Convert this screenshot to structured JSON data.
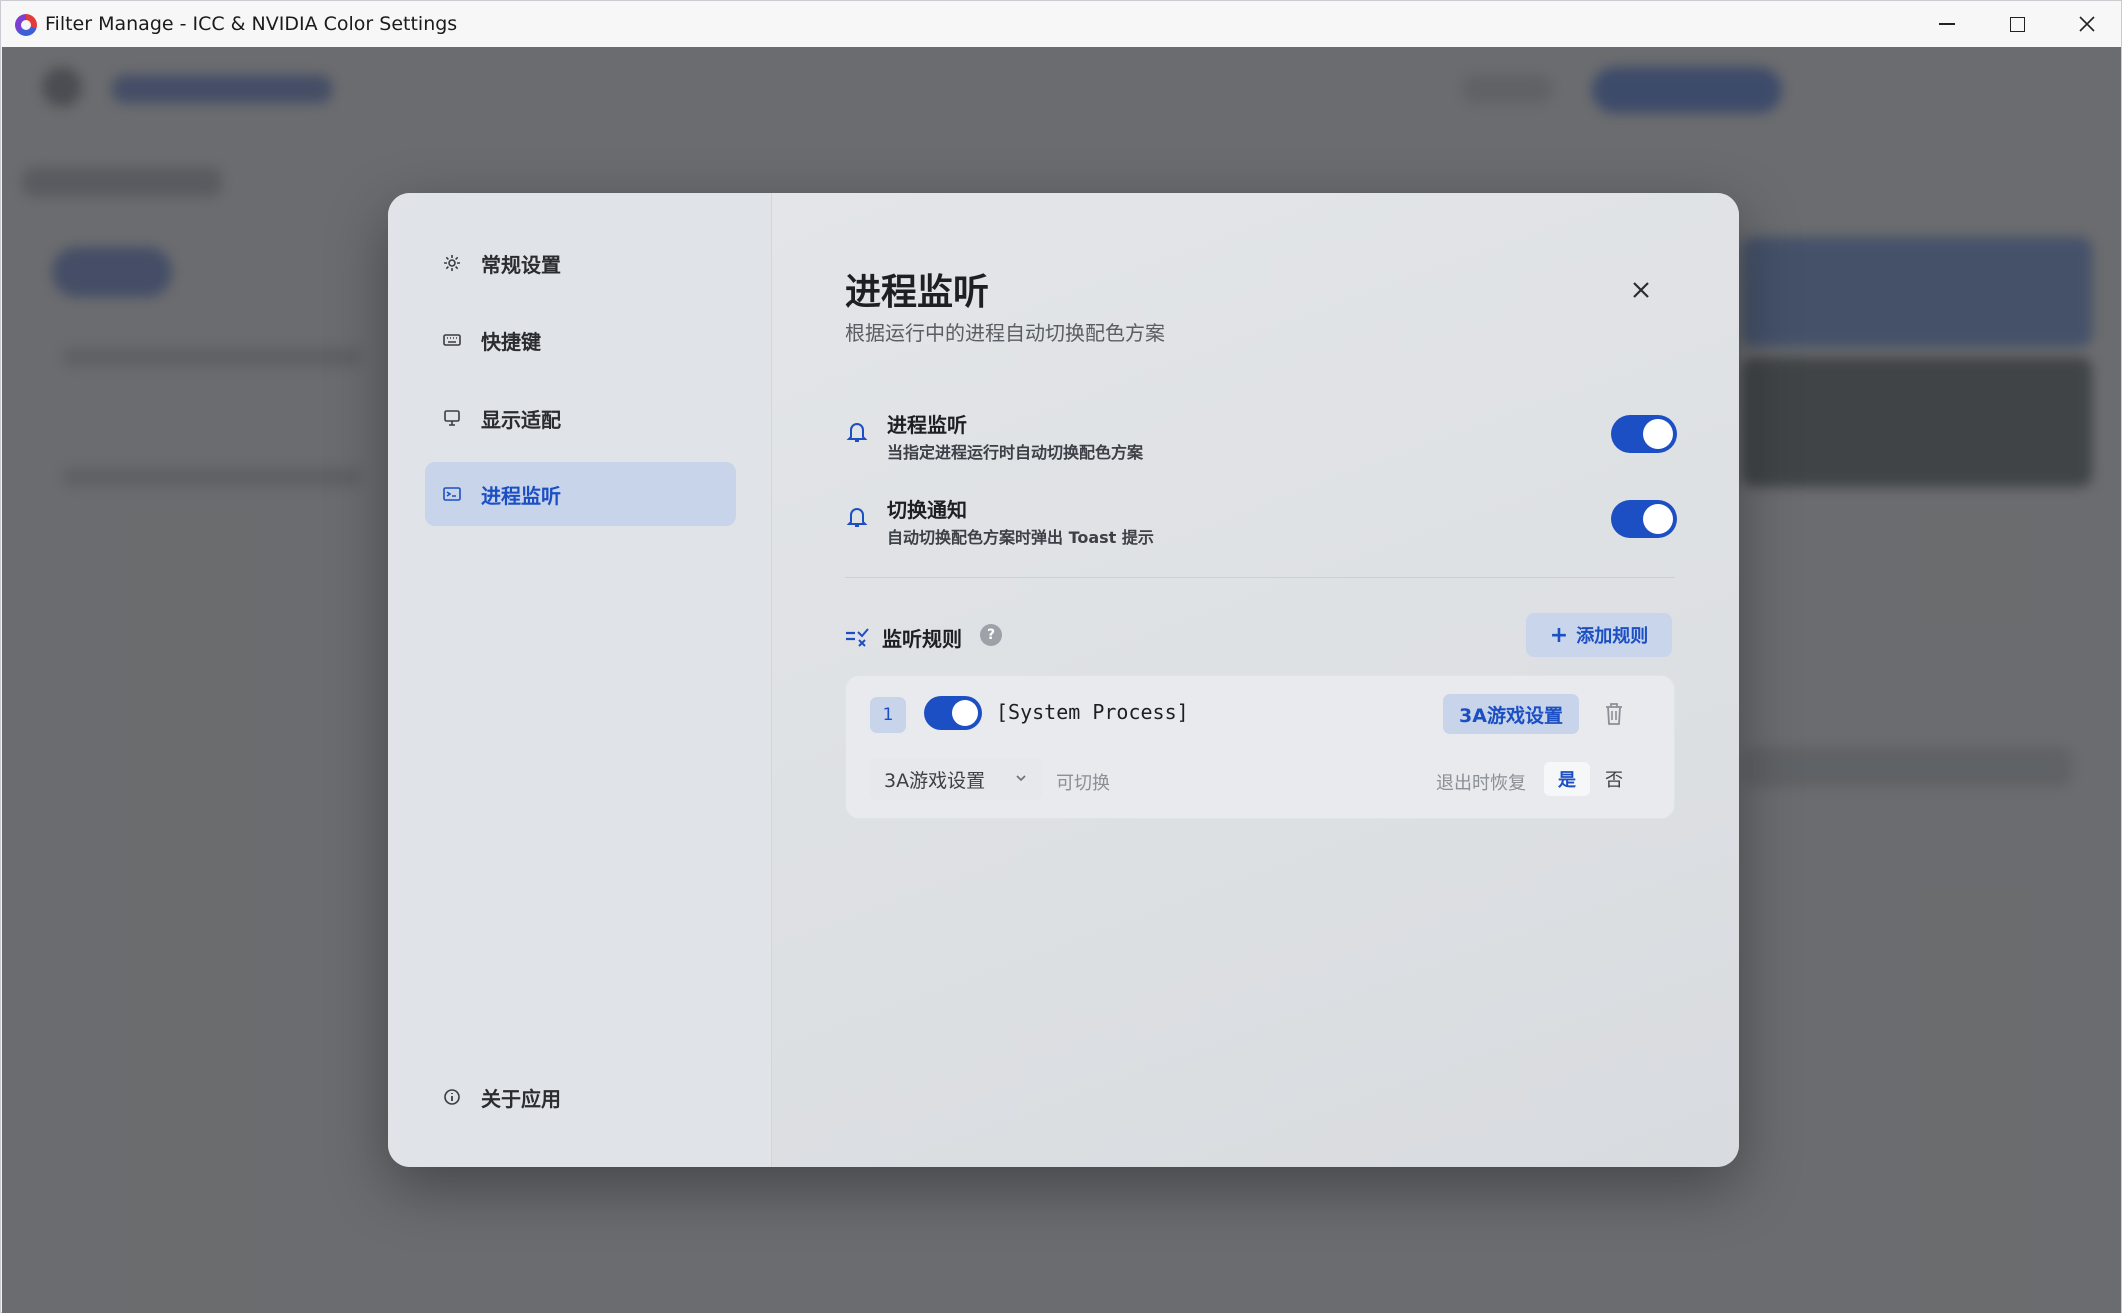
{
  "window": {
    "title": "Filter Manage - ICC & NVIDIA Color Settings",
    "icons": [
      "app-logo-icon",
      "minimize-icon",
      "maximize-icon",
      "close-icon"
    ]
  },
  "sidebar": {
    "items": [
      {
        "label": "常规设置",
        "icon": "gear-icon"
      },
      {
        "label": "快捷键",
        "icon": "keyboard-icon"
      },
      {
        "label": "显示适配",
        "icon": "monitor-icon"
      },
      {
        "label": "进程监听",
        "icon": "terminal-icon",
        "active": true
      }
    ],
    "footer": {
      "label": "关于应用",
      "icon": "info-icon"
    }
  },
  "panel": {
    "title": "进程监听",
    "subtitle": "根据运行中的进程自动切换配色方案",
    "settings": [
      {
        "title": "进程监听",
        "description": "当指定进程运行时自动切换配色方案",
        "enabled": true,
        "icon": "bell-icon"
      },
      {
        "title": "切换通知",
        "description": "自动切换配色方案时弹出 Toast 提示",
        "enabled": true,
        "icon": "bell-icon"
      }
    ],
    "rules_section": {
      "title": "监听规则",
      "help": "?",
      "add_button": "添加规则",
      "add_icon": "+"
    },
    "rules": [
      {
        "index": "1",
        "enabled": true,
        "process": "[System Process]",
        "tag": "3A游戏设置",
        "profile_select": "3A游戏设置",
        "switchable_label": "可切换",
        "restore_label": "退出时恢复",
        "restore_yes": "是",
        "restore_no": "否",
        "restore_value": "是"
      }
    ]
  },
  "colors": {
    "accent": "#1d4fc4",
    "accent_soft": "#c7d4ea",
    "overlay": "#46484a"
  }
}
